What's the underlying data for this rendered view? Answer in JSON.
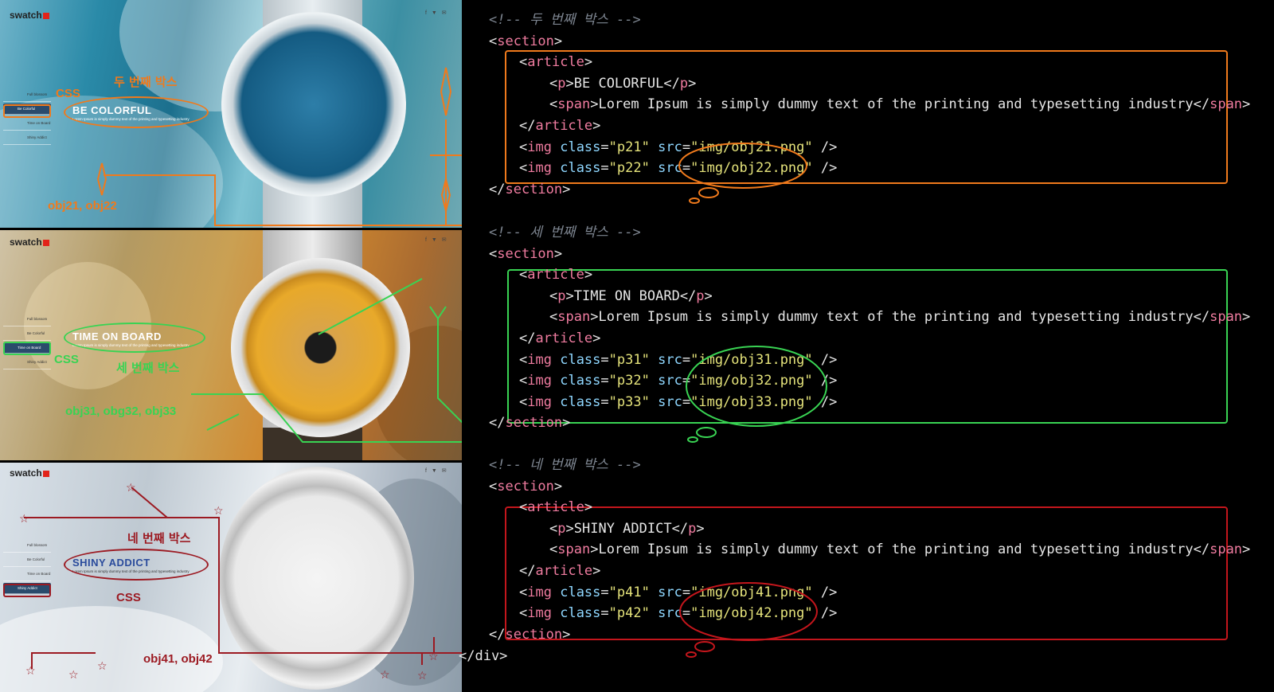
{
  "colors": {
    "orange": "#f07a1c",
    "green": "#39d353",
    "red": "#c4161c",
    "brand_red": "#e2231a",
    "menu_active": "#2a4b6c"
  },
  "site": {
    "logo": "swatch",
    "social_icons": [
      "facebook-icon",
      "twitter-icon",
      "mail-icon"
    ],
    "menu": [
      "Full blossom",
      "Be Colorful",
      "Time on Board",
      "Shiny Addict"
    ],
    "lorem": "Lorem Ipsum is simply dummy text of the printing and typesetting industry"
  },
  "slides": [
    {
      "headline": "BE COLORFUL",
      "box_label": "두 번째 박스",
      "css_label": "CSS",
      "obj_label": "obj21, obj22"
    },
    {
      "headline": "TIME ON BOARD",
      "box_label": "세 번째 박스",
      "css_label": "CSS",
      "obj_label": "obj31, obg32, obj33"
    },
    {
      "headline": "SHINY ADDICT",
      "box_label": "네 번째 박스",
      "css_label": "CSS",
      "obj_label": "obj41, obj42"
    }
  ],
  "code": {
    "sections": [
      {
        "comment": "<!-- 두 번째 박스 -->",
        "title": "BE COLORFUL",
        "imgs": [
          {
            "cls": "p21",
            "src": "img/obj21.png"
          },
          {
            "cls": "p22",
            "src": "img/obj22.png"
          }
        ]
      },
      {
        "comment": "<!-- 세 번째 박스 -->",
        "title": "TIME ON BOARD",
        "imgs": [
          {
            "cls": "p31",
            "src": "img/obj31.png"
          },
          {
            "cls": "p32",
            "src": "img/obj32.png"
          },
          {
            "cls": "p33",
            "src": "img/obj33.png"
          }
        ]
      },
      {
        "comment": "<!-- 네 번째 박스 -->",
        "title": "SHINY ADDICT",
        "imgs": [
          {
            "cls": "p41",
            "src": "img/obj41.png"
          },
          {
            "cls": "p42",
            "src": "img/obj42.png"
          }
        ]
      }
    ],
    "span_text": "Lorem Ipsum is simply dummy text of the printing and typesetting industry",
    "closing": "</div>"
  }
}
